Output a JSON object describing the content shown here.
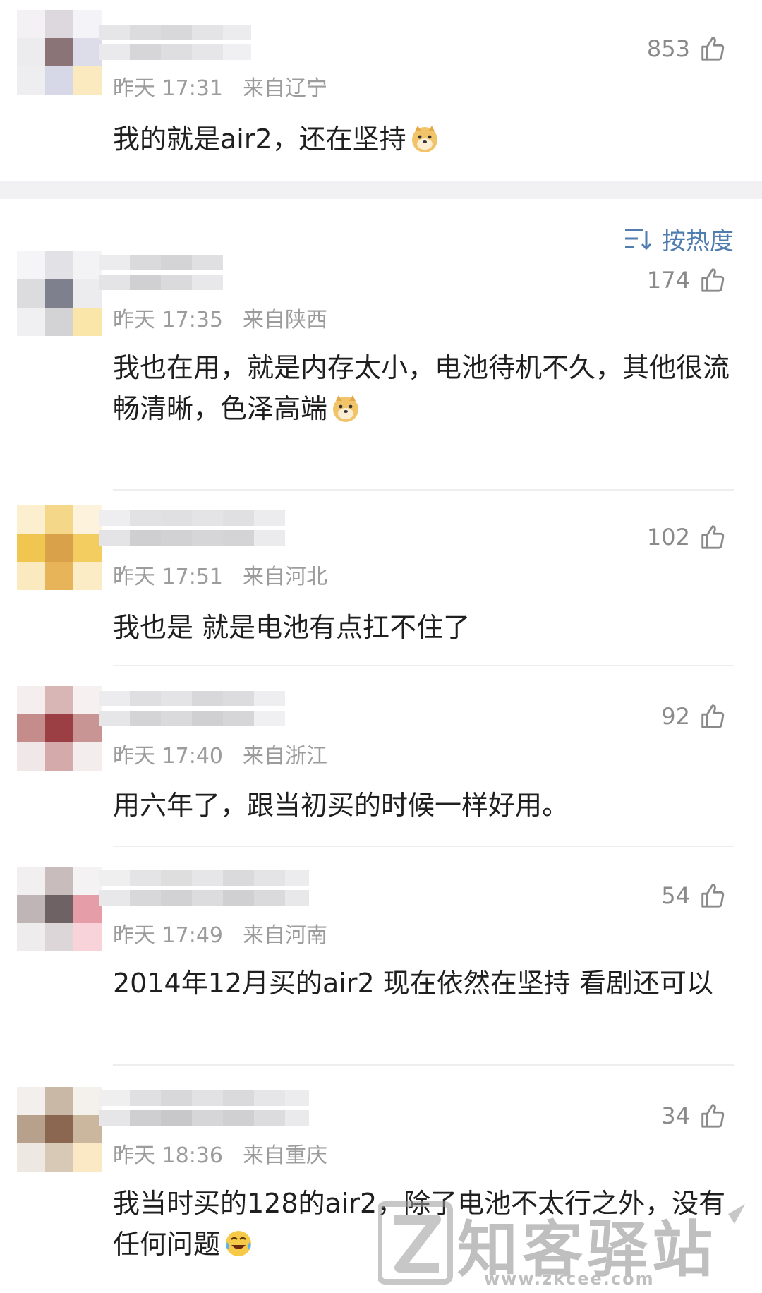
{
  "top_comment": {
    "time": "昨天 17:31",
    "location": "来自辽宁",
    "likes": "853",
    "text": "我的就是air2，还在坚持"
  },
  "sort": {
    "label": "按热度"
  },
  "comments": [
    {
      "time": "昨天 17:35",
      "location": "来自陕西",
      "likes": "174",
      "text": "我也在用，就是内存太小，电池待机不久，其他很流畅清晰，色泽高端"
    },
    {
      "time": "昨天 17:51",
      "location": "来自河北",
      "likes": "102",
      "text": "我也是 就是电池有点扛不住了"
    },
    {
      "time": "昨天 17:40",
      "location": "来自浙江",
      "likes": "92",
      "text": "用六年了，跟当初买的时候一样好用。"
    },
    {
      "time": "昨天 17:49",
      "location": "来自河南",
      "likes": "54",
      "text": "2014年12月买的air2 现在依然在坚持 看剧还可以"
    },
    {
      "time": "昨天 18:36",
      "location": "来自重庆",
      "likes": "34",
      "text": "我当时买的128的air2，除了电池不太行之外，没有任何问题"
    }
  ],
  "watermark": {
    "brand": "知客驿站",
    "url": "www.zkcee.com"
  },
  "icons": {
    "like": "thumbs-up-icon",
    "sort": "sort-icon",
    "emoji_doge": "doge-emoji-icon",
    "emoji_laugh": "laugh-cry-emoji-icon"
  },
  "colors": {
    "accent": "#507daf",
    "meta": "#9c9c9c",
    "text": "#1f1f1f"
  }
}
